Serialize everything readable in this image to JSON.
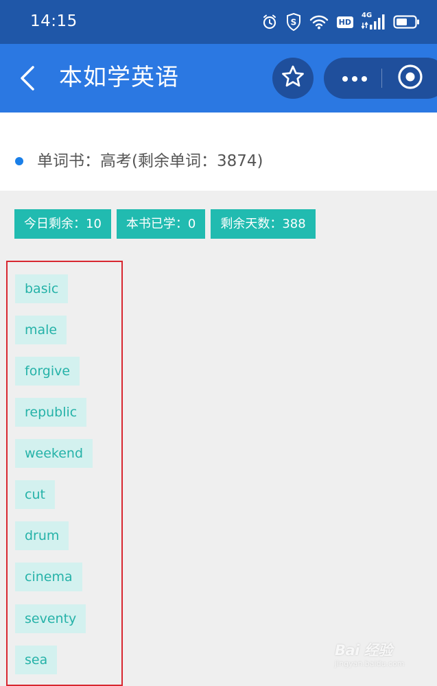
{
  "status_bar": {
    "time": "14:15",
    "network": "4G",
    "hd_badge": "HD",
    "icons": [
      "alarm-icon",
      "shield-s-icon",
      "wifi-icon",
      "hd-icon",
      "signal-4g-icon",
      "battery-icon"
    ]
  },
  "nav": {
    "title": "本如学英语",
    "icons": [
      "back-arrow-icon",
      "star-icon",
      "more-dots-icon",
      "target-icon"
    ],
    "color": "#2b78e2"
  },
  "book": {
    "label": "单词书：高考(剩余单词：3874)"
  },
  "stats": [
    {
      "label": "今日剩余：10"
    },
    {
      "label": "本书已学：0"
    },
    {
      "label": "剩余天数：388"
    }
  ],
  "words": [
    {
      "word": "basic"
    },
    {
      "word": "male"
    },
    {
      "word": "forgive"
    },
    {
      "word": "republic"
    },
    {
      "word": "weekend"
    },
    {
      "word": "cut"
    },
    {
      "word": "drum"
    },
    {
      "word": "cinema"
    },
    {
      "word": "seventy"
    },
    {
      "word": "sea"
    }
  ],
  "watermark": {
    "brand": "Bai 经验",
    "site": "jingyan.baidu.com"
  },
  "colors": {
    "accent_teal": "#21bbb0",
    "word_bg": "#d3f1ef",
    "highlight_border": "#d8262f"
  }
}
